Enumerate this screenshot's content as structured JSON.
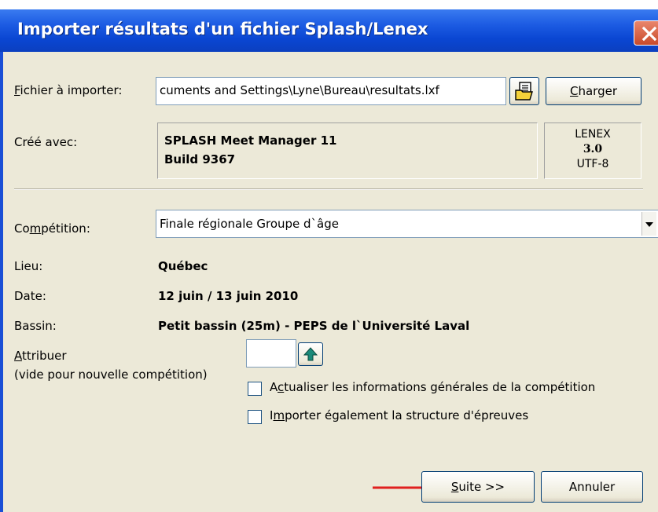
{
  "window": {
    "title": "Importer résultats d'un fichier Splash/Lenex"
  },
  "file": {
    "label_key": "F",
    "label_rest": "ichier à importer:",
    "path": "cuments and Settings\\Lyne\\Bureau\\resultats.lxf",
    "load_key": "C",
    "load_rest": "harger"
  },
  "created": {
    "label": "Créé avec:",
    "app_line1": "SPLASH Meet Manager 11",
    "app_line2": "Build 9367",
    "format_line1": "LENEX",
    "format_line2": "3.0",
    "format_line3": "UTF-8"
  },
  "competition": {
    "label_pre": "Co",
    "label_key": "m",
    "label_post": "pétition:",
    "selected": "Finale régionale Groupe d`âge"
  },
  "details": {
    "lieu_label": "Lieu:",
    "lieu_value": "Québec",
    "date_label": "Date:",
    "date_value": "12 juin / 13 juin 2010",
    "bassin_label": "Bassin:",
    "bassin_value": "Petit bassin (25m) - PEPS de l`Université Laval"
  },
  "assign": {
    "label_key": "A",
    "label_rest": "ttribuer",
    "hint": "(vide pour nouvelle compétition)",
    "value": ""
  },
  "options": {
    "update_pre": "A",
    "update_key": "c",
    "update_post": "tualiser les informations générales de la compétition",
    "update_checked": false,
    "structure_pre": "I",
    "structure_key": "m",
    "structure_post": "porter également la structure d'épreuves",
    "structure_checked": false
  },
  "footer": {
    "next_key": "S",
    "next_rest": "uite >>",
    "cancel": "Annuler"
  },
  "colors": {
    "titlebar": "#0a46d2",
    "dialog_bg": "#ece9d8",
    "arrow": "#e0201e",
    "upload_icon": "#1a8a7a"
  }
}
